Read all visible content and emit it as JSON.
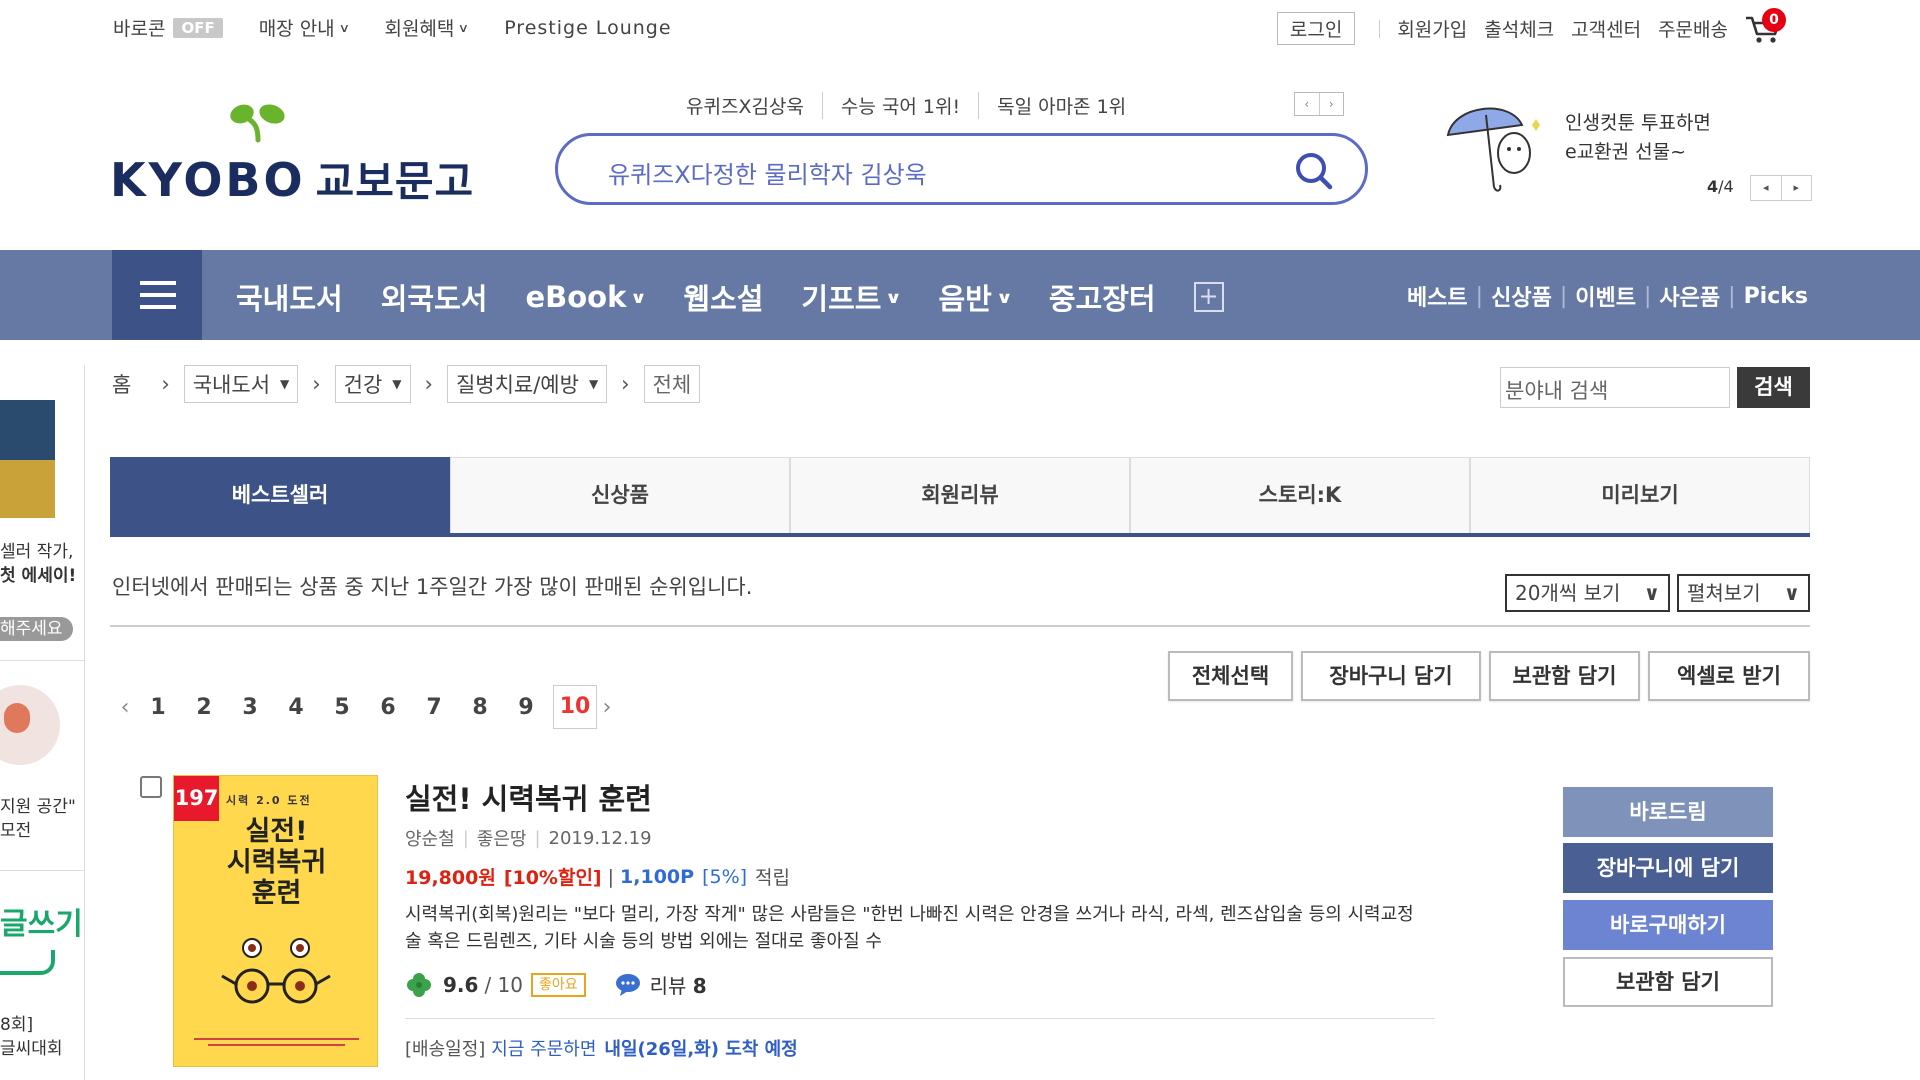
{
  "topbar": {
    "baro": "바로콘",
    "baro_status": "OFF",
    "store_info": "매장 안내",
    "member_benefit": "회원혜택",
    "prestige": "Prestige Lounge",
    "login": "로그인",
    "signup": "회원가입",
    "attendance": "출석체크",
    "customer_center": "고객센터",
    "order_delivery": "주문배송",
    "cart_count": "0"
  },
  "logo": {
    "en": "KYOBO",
    "kr": "교보문고"
  },
  "search": {
    "keywords": [
      "유퀴즈X김상욱",
      "수능 국어 1위!",
      "독일 아마존 1위"
    ],
    "placeholder": "유퀴즈X다정한 물리학자 김상욱",
    "prev": "‹",
    "next": "›"
  },
  "promo": {
    "line1": "인생컷툰 투표하면",
    "line2": "e교환권 선물~",
    "page_current": "4",
    "page_total": "/4",
    "prev": "◂",
    "next": "▸"
  },
  "nav": {
    "items": [
      "국내도서",
      "외국도서",
      "eBook",
      "웹소설",
      "기프트",
      "음반",
      "중고장터"
    ],
    "right": [
      "베스트",
      "신상품",
      "이벤트",
      "사은품",
      "Picks"
    ]
  },
  "leftstrip": {
    "t1": "셀러 작가,",
    "t2": "첫 에세이!",
    "t3": "해주세요",
    "t4": "지원 공간\"",
    "t5": "모전",
    "t6": "글쓰기",
    "t7": "8회]",
    "t8": "글씨대회"
  },
  "breadcrumb": {
    "home": "홈",
    "level1": "국내도서",
    "level2": "건강",
    "level3": "질병치료/예방",
    "current": "전체"
  },
  "inner_search": {
    "placeholder": "분야내 검색",
    "button": "검색"
  },
  "tabs": [
    "베스트셀러",
    "신상품",
    "회원리뷰",
    "스토리:K",
    "미리보기"
  ],
  "list": {
    "description": "인터넷에서 판매되는 상품 중 지난 1주일간 가장 많이 판매된 순위입니다.",
    "per_page": "20개씩 보기",
    "view_mode": "펼쳐보기",
    "pages": [
      "1",
      "2",
      "3",
      "4",
      "5",
      "6",
      "7",
      "8",
      "9",
      "10"
    ],
    "current_page": "10",
    "actions": [
      "전체선택",
      "장바구니 담기",
      "보관함 담기",
      "엑셀로 받기"
    ]
  },
  "product": {
    "rank": "197",
    "cover_series": "시력 2.0 도전",
    "cover_title_1": "실전!",
    "cover_title_2": "시력복귀",
    "cover_title_3": "훈련",
    "title": "실전! 시력복귀 훈련",
    "author": "양순철",
    "publisher": "좋은땅",
    "date": "2019.12.19",
    "price": "19,800원",
    "discount": "[10%할인]",
    "points": "1,100P",
    "points_rate": "[5%]",
    "points_label": "적립",
    "description": "시력복귀(회복)원리는 \"보다 멀리, 가장 작게\" 많은 사람들은 \"한번 나빠진 시력은 안경을 쓰거나 라식, 라섹, 렌즈삽입술 등의 시력교정술 혹은 드림렌즈, 기타 시술 등의 방법 외에는 절대로 좋아질 수",
    "rating": "9.6",
    "rating_max": "/ 10",
    "like_label": "좋아요",
    "review_label": "리뷰",
    "review_count": "8",
    "ship_prefix": "[배송일정]",
    "ship_mid": "지금 주문하면",
    "ship_date": "내일(26일,화) 도착 예정",
    "buttons": [
      "바로드림",
      "장바구니에 담기",
      "바로구매하기",
      "보관함 담기"
    ]
  },
  "colors": {
    "nav_bg": "#6679a5",
    "nav_dark": "#3d5287",
    "search_border": "#5b6bc7",
    "price_red": "#d21",
    "point_blue": "#2f6bd6"
  }
}
